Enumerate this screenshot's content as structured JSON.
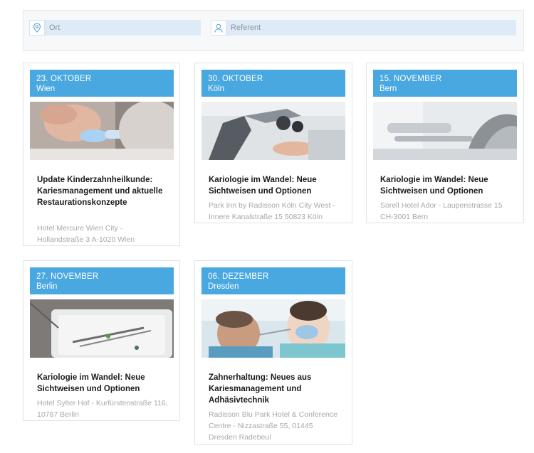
{
  "filters": {
    "location_placeholder": "Ort",
    "speaker_placeholder": "Referent",
    "location_icon": "map-pin-icon",
    "speaker_icon": "user-icon"
  },
  "colors": {
    "accent": "#4aa8e0",
    "field_bg": "#deebf7"
  },
  "events": [
    {
      "date": "23. OKTOBER",
      "city": "Wien",
      "title": "Update Kinderzahnheilkunde: Kariesmanagement und aktuelle Restaurationskonzepte",
      "venue": "Hotel Mercure Wien City - Hollandstraße 3 A-1020 Wien"
    },
    {
      "date": "30. OKTOBER",
      "city": "Köln",
      "title": "Kariologie im Wandel: Neue Sichtweisen und Optionen",
      "venue": "Park Inn by Radisson Köln City West - Innere Kanalstraße 15 50823 Köln"
    },
    {
      "date": "15. NOVEMBER",
      "city": "Bern",
      "title": "Kariologie im Wandel: Neue Sichtweisen und Optionen",
      "venue": "Sorell Hotel Ador - Laupenstrasse 15 CH-3001 Bern"
    },
    {
      "date": "27. NOVEMBER",
      "city": "Berlin",
      "title": "Kariologie im Wandel: Neue Sichtweisen und Optionen",
      "venue": "Hotel Sylter Hof - Kurfürstenstraße 116, 10787 Berlin"
    },
    {
      "date": "06. DEZEMBER",
      "city": "Dresden",
      "title": "Zahnerhaltung: Neues aus Kariesmanagement und Adhäsivtechnik",
      "venue": "Radisson Blu Park Hotel & Conference Centre - Nizzastraße 55, 01445 Dresden Radebeul"
    }
  ]
}
